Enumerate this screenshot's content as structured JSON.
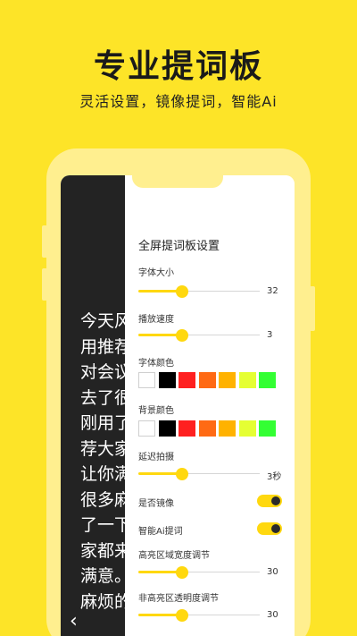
{
  "hero": {
    "title": "专业提词板",
    "subtitle": "灵活设置，镜像提词，智能Ai"
  },
  "teleprompter": {
    "lines": [
      "今天风",
      "用推荐",
      "对会议",
      "去了很",
      "刚用了",
      "荐大家",
      "让你满",
      "很多麻",
      "了一下",
      "家都来",
      "满意。",
      "麻烦的"
    ],
    "back_icon": "chevron-left-icon"
  },
  "settings": {
    "title": "全屏提词板设置",
    "font_size": {
      "label": "字体大小",
      "value": "32",
      "level": 0.36
    },
    "speed": {
      "label": "播放速度",
      "value": "3",
      "level": 0.36
    },
    "font_color": {
      "label": "字体颜色",
      "swatches": [
        "#FFFFFF",
        "#000000",
        "#FF2020",
        "#FF6A14",
        "#FFB200",
        "#E5FF33",
        "#33FF33"
      ]
    },
    "bg_color": {
      "label": "背景颜色",
      "swatches": [
        "#FFFFFF",
        "#000000",
        "#FF2020",
        "#FF6A14",
        "#FFB200",
        "#E5FF33",
        "#33FF33"
      ]
    },
    "delay": {
      "label": "延迟拍摄",
      "value": "3秒",
      "level": 0.36
    },
    "mirror": {
      "label": "是否镜像",
      "on": true
    },
    "ai_prompt": {
      "label": "智能Ai提词",
      "on": true
    },
    "highlight_width": {
      "label": "高亮区域宽度调节",
      "value": "30",
      "level": 0.36
    },
    "non_highlight_opacity": {
      "label": "非高亮区透明度调节",
      "value": "30",
      "level": 0.36
    }
  },
  "colors": {
    "accent": "#FFD80F",
    "background": "#FDE428",
    "dark_pane": "#232323"
  }
}
